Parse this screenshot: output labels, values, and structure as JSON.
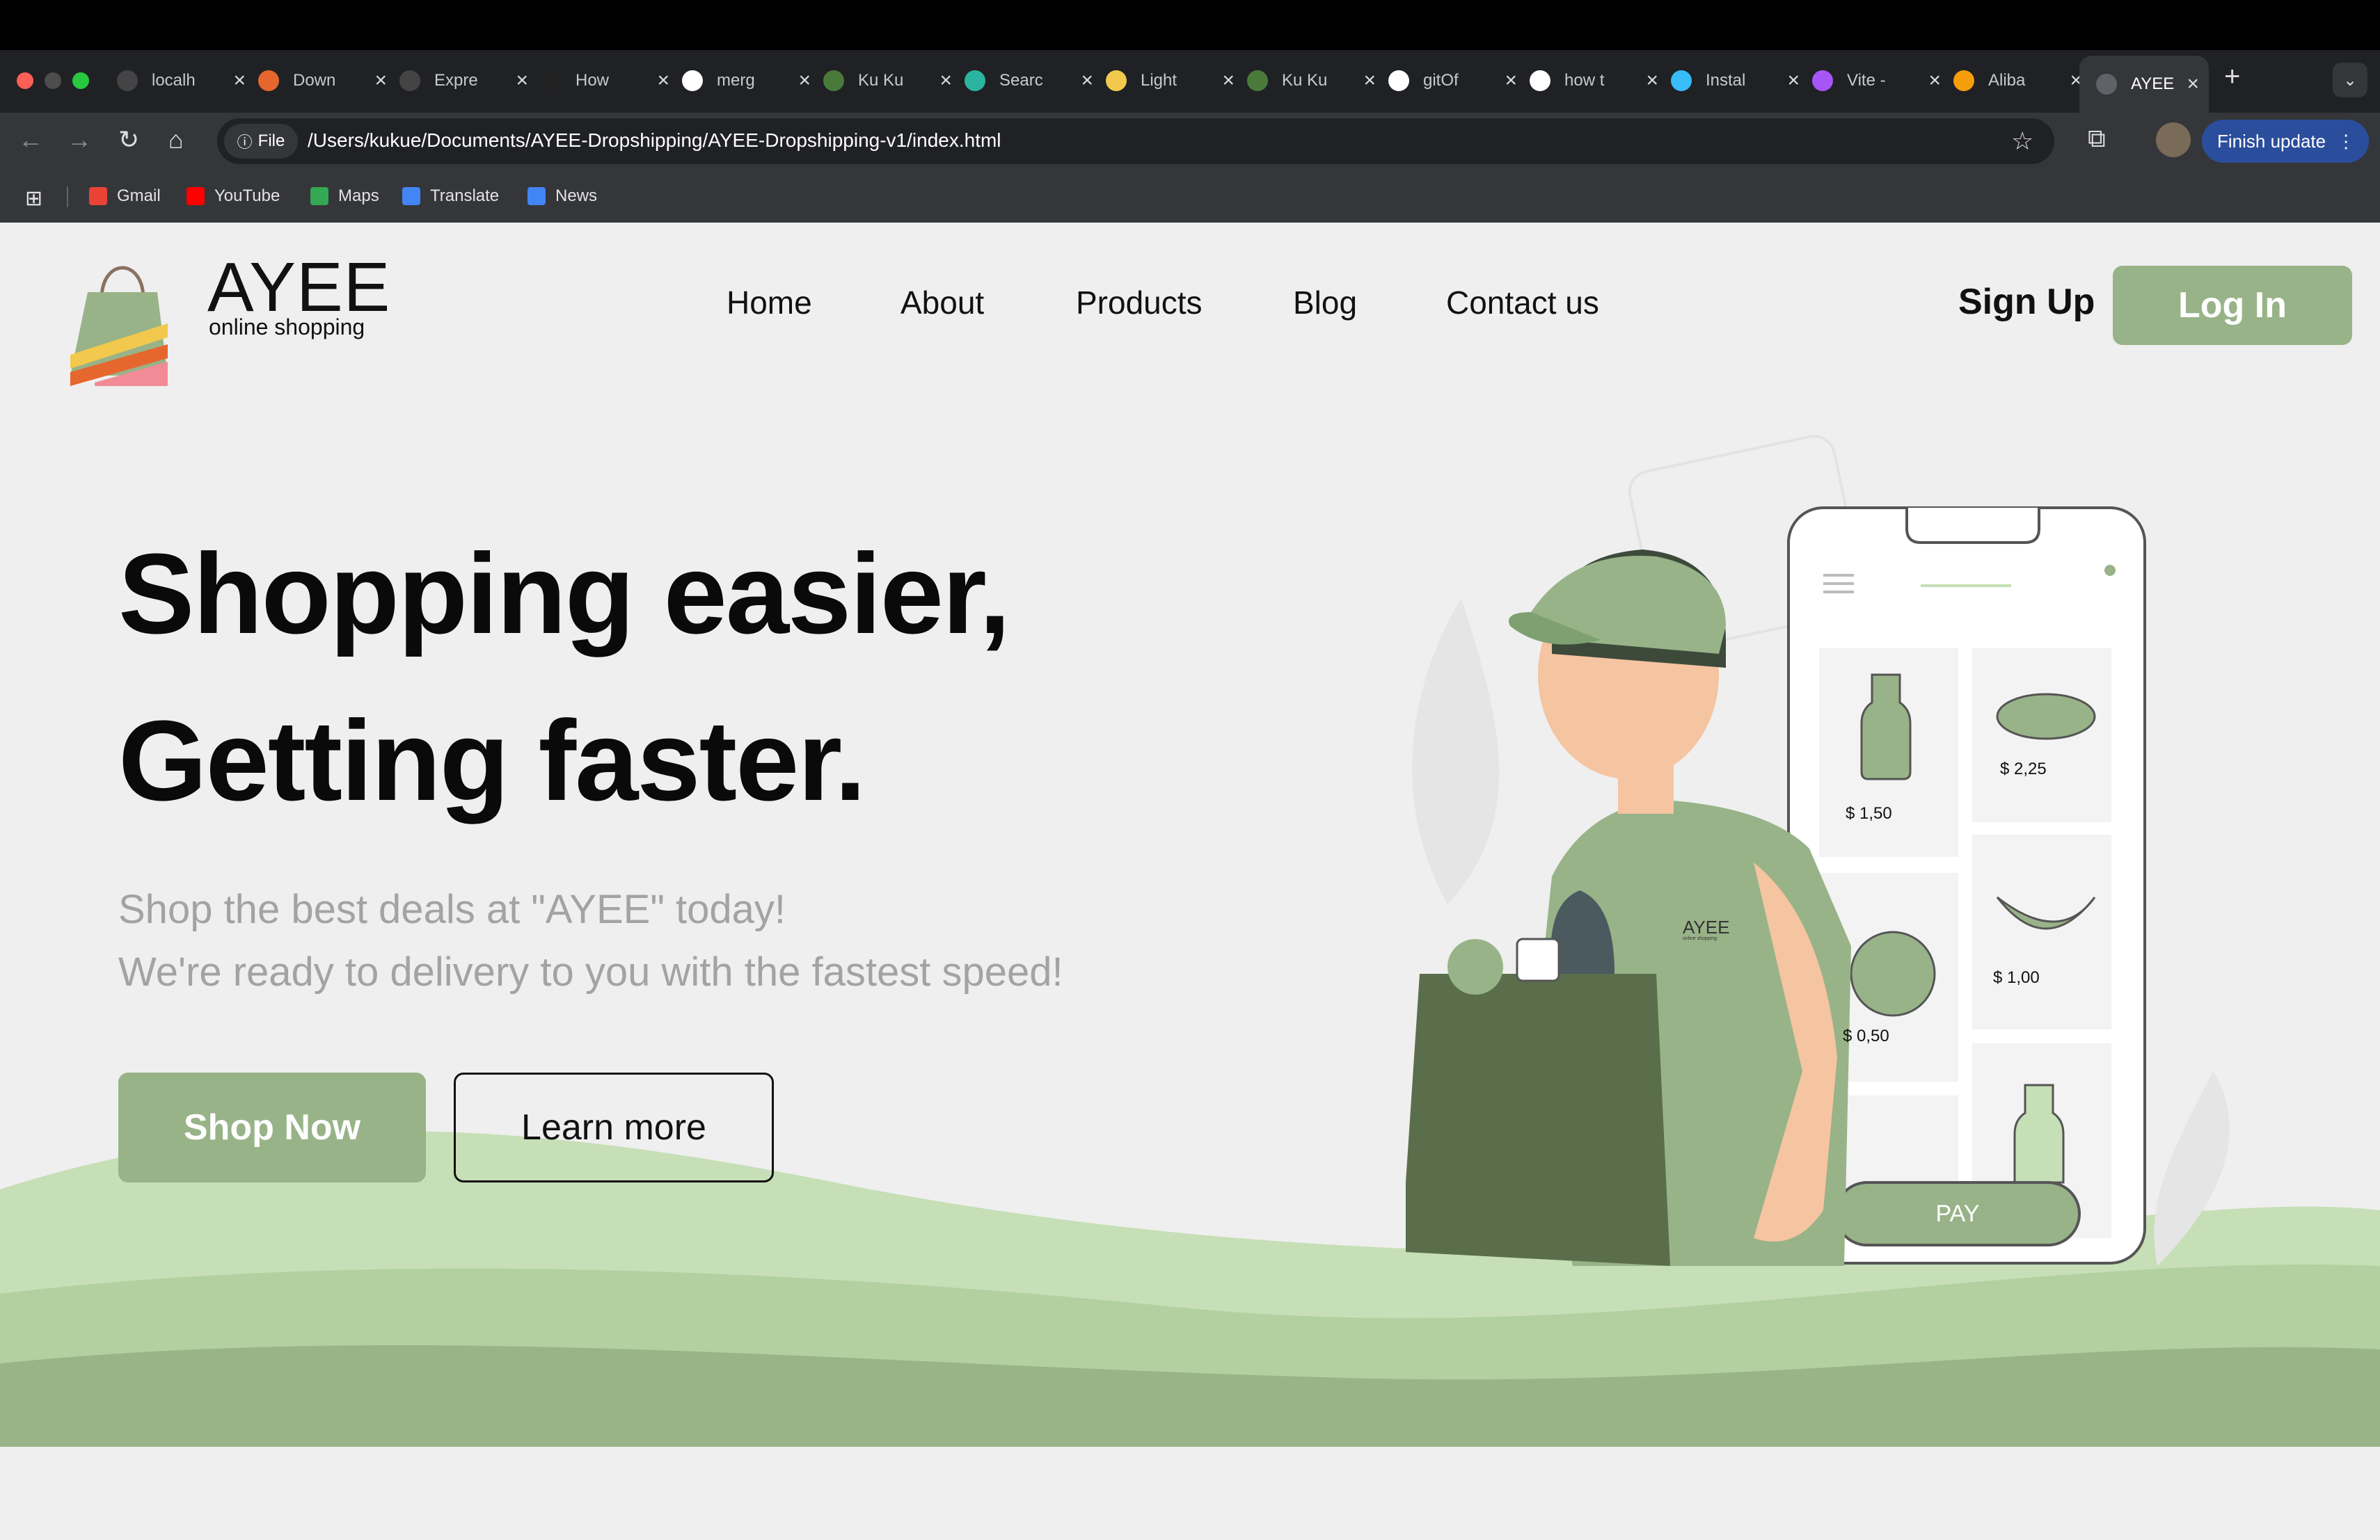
{
  "browser": {
    "tabs": [
      {
        "title": "localh",
        "color": "#444"
      },
      {
        "title": "Down",
        "color": "#e5672e"
      },
      {
        "title": "Expre",
        "color": "#444"
      },
      {
        "title": "How",
        "color": "#222"
      },
      {
        "title": "merg",
        "color": "#fff"
      },
      {
        "title": "Ku Ku",
        "color": "#4a7a3a"
      },
      {
        "title": "Searc",
        "color": "#2bb5a0"
      },
      {
        "title": "Light",
        "color": "#f2c94c"
      },
      {
        "title": "Ku Ku",
        "color": "#4a7a3a"
      },
      {
        "title": "gitOf",
        "color": "#fff"
      },
      {
        "title": "how t",
        "color": "#fff"
      },
      {
        "title": "Instal",
        "color": "#38bdf8"
      },
      {
        "title": "Vite -",
        "color": "#a855f7"
      },
      {
        "title": "Aliba",
        "color": "#f59e0b"
      }
    ],
    "active_tab": "AYEE",
    "url_chip": "File",
    "url": "/Users/kukue/Documents/AYEE-Dropshipping/AYEE-Dropshipping-v1/index.html",
    "finish_update": "Finish update",
    "bookmarks": [
      {
        "label": "Gmail",
        "color": "#ea4335"
      },
      {
        "label": "YouTube",
        "color": "#ff0000"
      },
      {
        "label": "Maps",
        "color": "#34a853"
      },
      {
        "label": "Translate",
        "color": "#4285f4"
      },
      {
        "label": "News",
        "color": "#4285f4"
      }
    ]
  },
  "site": {
    "brand": "AYEE",
    "tagline": "online shopping",
    "nav": [
      "Home",
      "About",
      "Products",
      "Blog",
      "Contact us"
    ],
    "signup": "Sign Up",
    "login": "Log In",
    "colors": {
      "accent": "#98b388",
      "hill_light": "#c6dfb6",
      "hill_mid": "#b2d0a0",
      "hill_dark": "#99b487"
    }
  },
  "hero": {
    "line1": "Shopping easier,",
    "line2": "Getting faster.",
    "sub1": "Shop the best deals at \"AYEE\" today!",
    "sub2": "We're ready to delivery to you with the fastest speed!",
    "shop_now": "Shop Now",
    "learn_more": "Learn more"
  },
  "illustration": {
    "shirt_brand": "AYEE",
    "shirt_tagline": "online shopping",
    "prices": [
      "$ 1,50",
      "$ 2,25",
      "$ 0,50",
      "$ 1,00"
    ],
    "pay": "PAY"
  }
}
